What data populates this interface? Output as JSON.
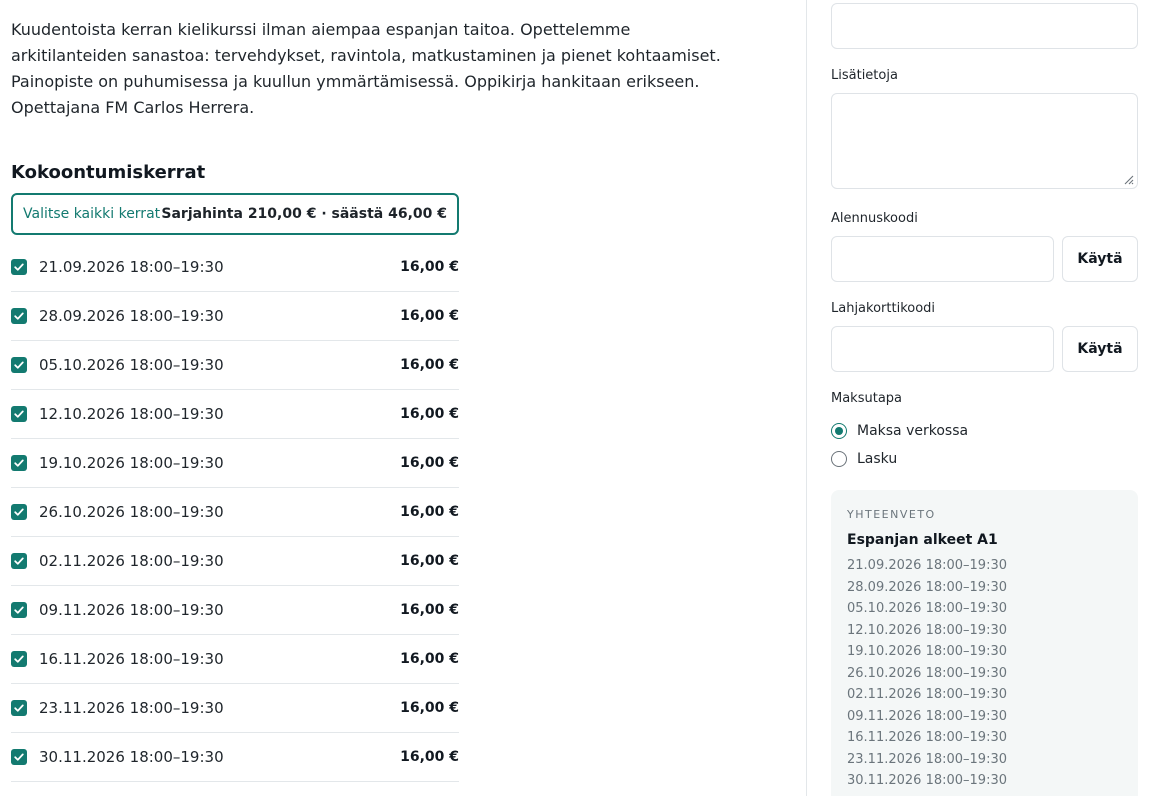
{
  "description": [
    "Kuudentoista kerran kielikurssi ilman aiempaa espanjan taitoa. Opettelemme",
    "arkitilanteiden sanastoa: tervehdykset, ravintola, matkustaminen ja pienet kohtaamiset.",
    "Painopiste on puhumisessa ja kuullun ymmärtämisessä. Oppikirja hankitaan erikseen.",
    "Opettajana FM Carlos Herrera."
  ],
  "sessions_section": {
    "title": "Kokoontumiskerrat",
    "select_all_label": "Valitse kaikki kerrat",
    "series_price_text": "Sarjahinta 210,00 € · säästä 46,00 €",
    "items": [
      {
        "date": "21.09.2026 18:00–19:30",
        "price": "16,00 €",
        "checked": true
      },
      {
        "date": "28.09.2026 18:00–19:30",
        "price": "16,00 €",
        "checked": true
      },
      {
        "date": "05.10.2026 18:00–19:30",
        "price": "16,00 €",
        "checked": true
      },
      {
        "date": "12.10.2026 18:00–19:30",
        "price": "16,00 €",
        "checked": true
      },
      {
        "date": "19.10.2026 18:00–19:30",
        "price": "16,00 €",
        "checked": true
      },
      {
        "date": "26.10.2026 18:00–19:30",
        "price": "16,00 €",
        "checked": true
      },
      {
        "date": "02.11.2026 18:00–19:30",
        "price": "16,00 €",
        "checked": true
      },
      {
        "date": "09.11.2026 18:00–19:30",
        "price": "16,00 €",
        "checked": true
      },
      {
        "date": "16.11.2026 18:00–19:30",
        "price": "16,00 €",
        "checked": true
      },
      {
        "date": "23.11.2026 18:00–19:30",
        "price": "16,00 €",
        "checked": true
      },
      {
        "date": "30.11.2026 18:00–19:30",
        "price": "16,00 €",
        "checked": true
      }
    ]
  },
  "form": {
    "top_input_value": "",
    "additional_info_label": "Lisätietoja",
    "additional_info_value": "",
    "discount_label": "Alennuskoodi",
    "discount_value": "",
    "discount_apply": "Käytä",
    "giftcard_label": "Lahjakorttikoodi",
    "giftcard_value": "",
    "giftcard_apply": "Käytä",
    "payment_label": "Maksutapa",
    "payment_options": [
      {
        "label": "Maksa verkossa",
        "selected": true
      },
      {
        "label": "Lasku",
        "selected": false
      }
    ]
  },
  "summary": {
    "heading": "YHTEENVETO",
    "course": "Espanjan alkeet A1",
    "dates": [
      "21.09.2026 18:00–19:30",
      "28.09.2026 18:00–19:30",
      "05.10.2026 18:00–19:30",
      "12.10.2026 18:00–19:30",
      "19.10.2026 18:00–19:30",
      "26.10.2026 18:00–19:30",
      "02.11.2026 18:00–19:30",
      "09.11.2026 18:00–19:30",
      "16.11.2026 18:00–19:30",
      "23.11.2026 18:00–19:30",
      "30.11.2026 18:00–19:30"
    ]
  },
  "colors": {
    "accent": "#137a70",
    "muted_text": "#6b757c",
    "summary_bg": "#f4f7f7"
  }
}
